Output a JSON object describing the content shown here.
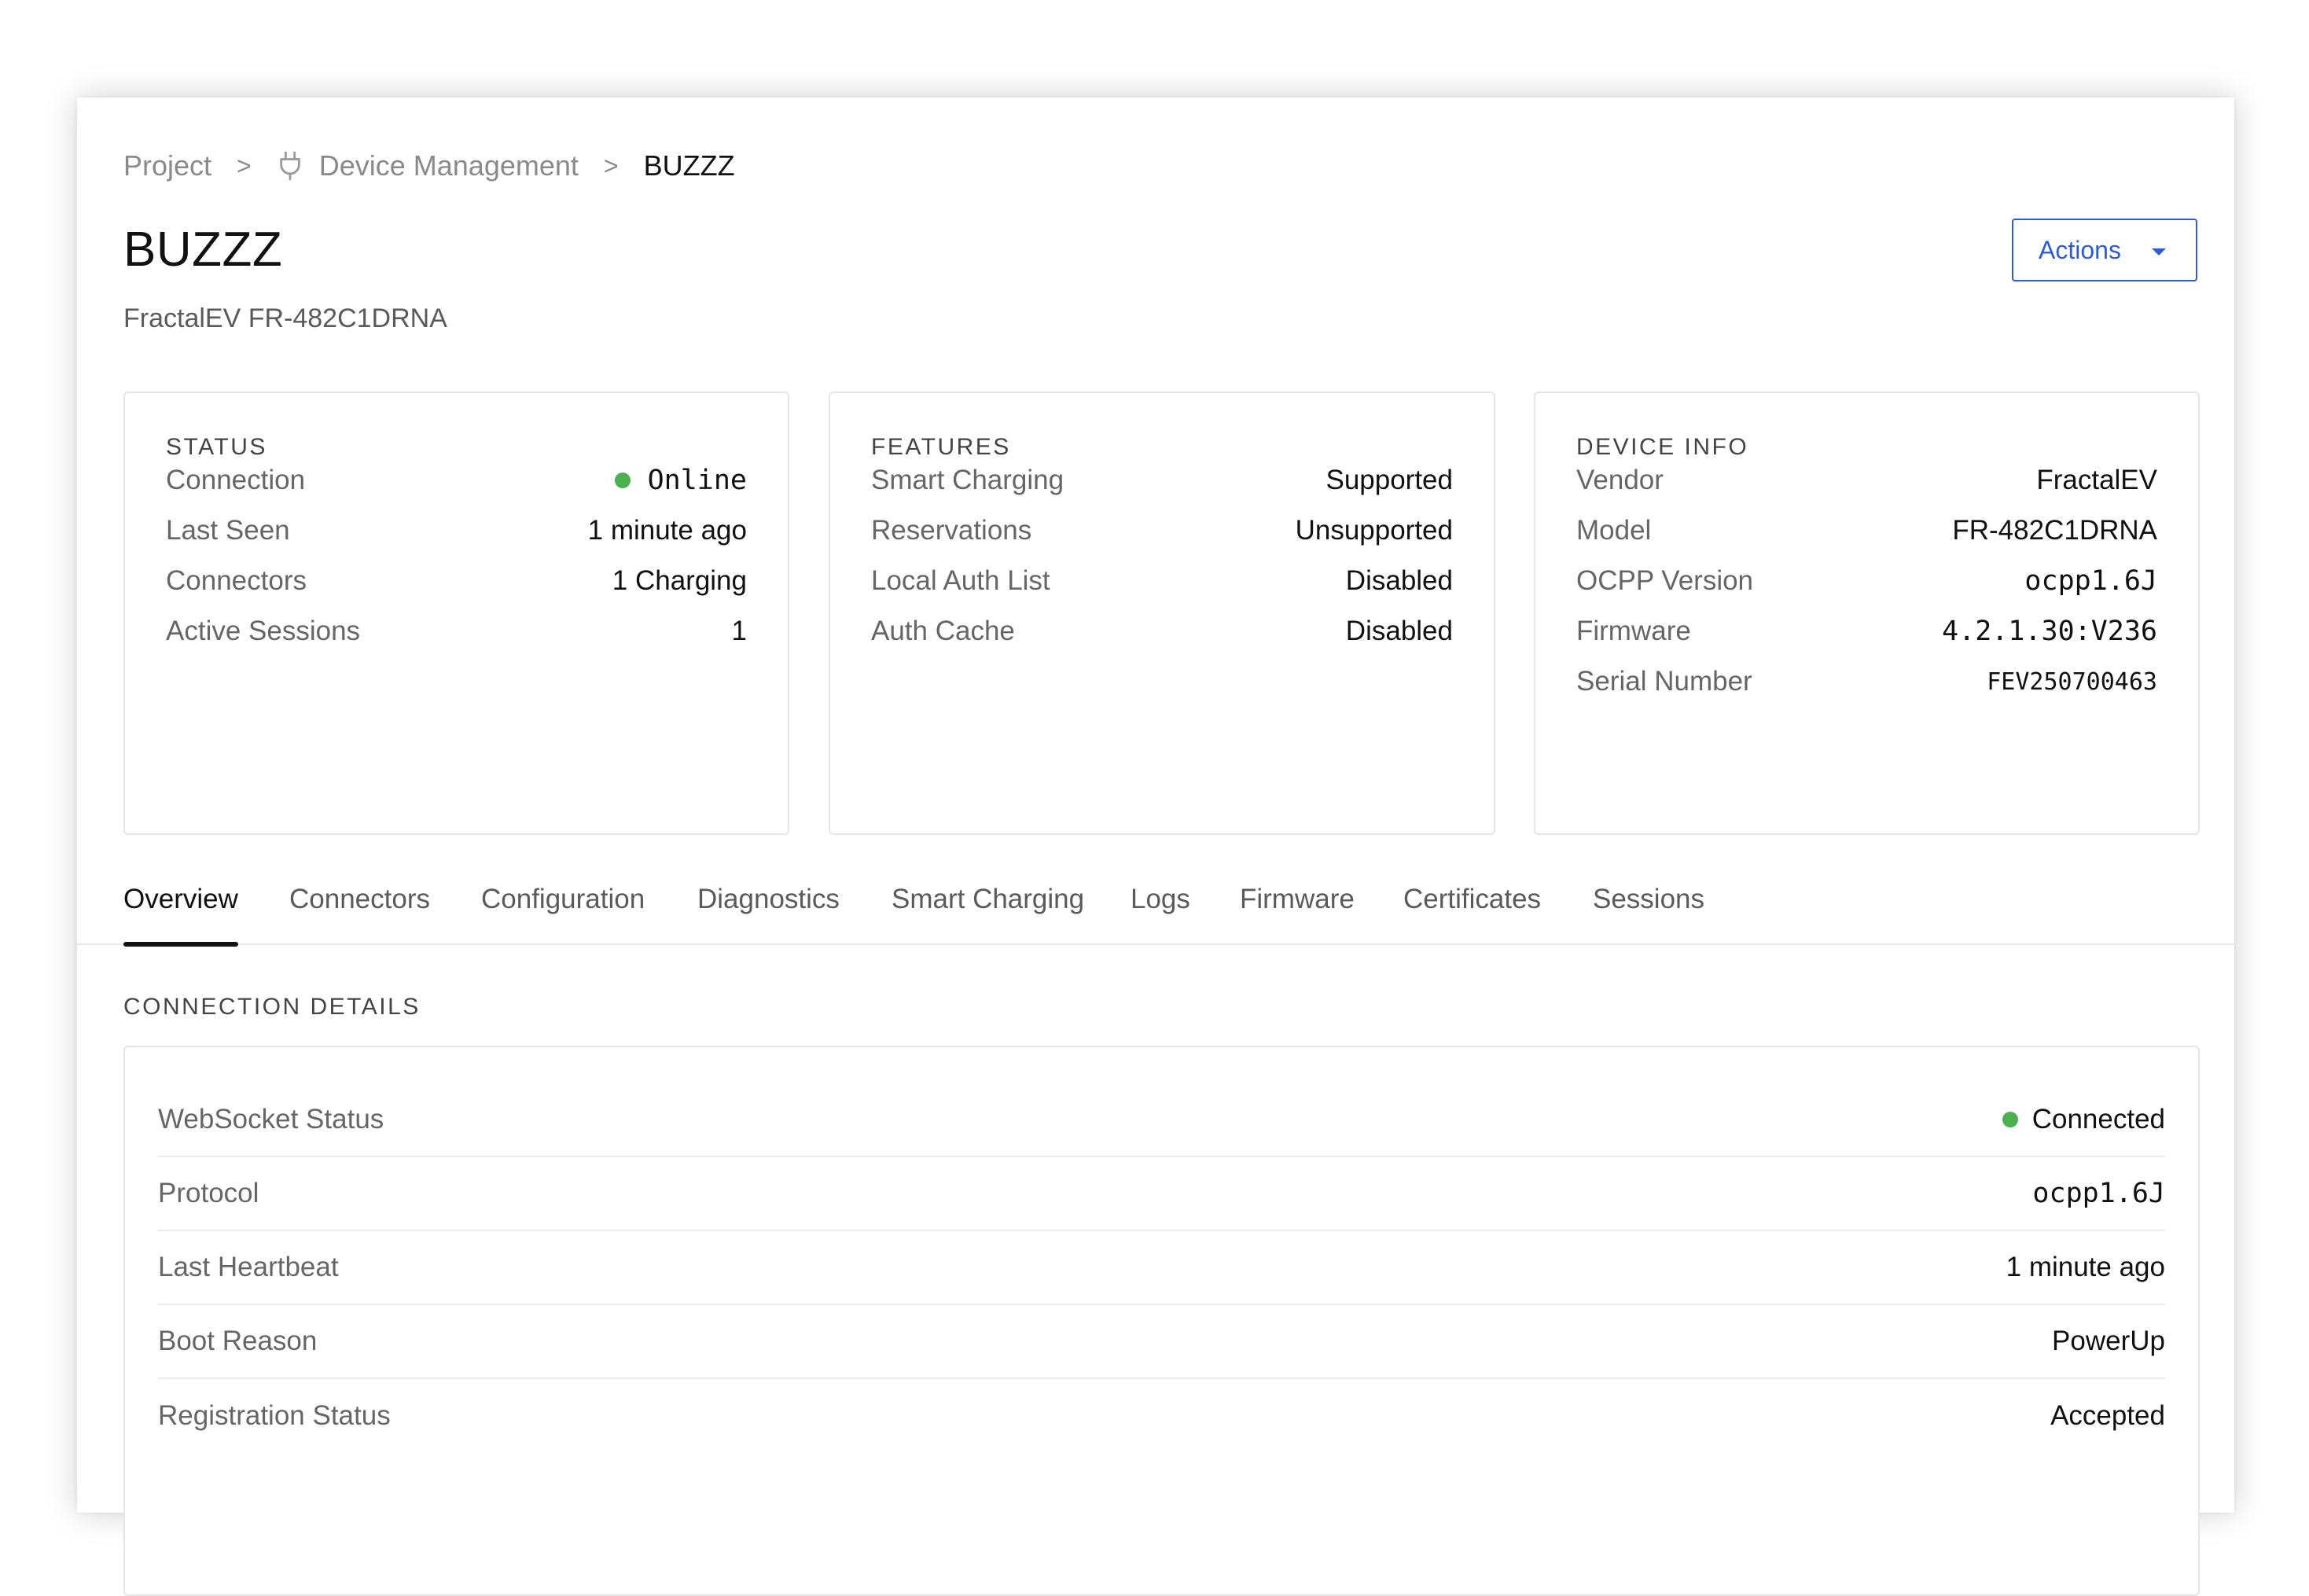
{
  "breadcrumb": {
    "project": "Project",
    "separator": ">",
    "device_management": "Device Management",
    "current": "BUZZZ",
    "icon": "plug-icon"
  },
  "header": {
    "title": "BUZZZ",
    "subtitle": "FractalEV FR-482C1DRNA",
    "actions_label": "Actions"
  },
  "status_card": {
    "title": "STATUS",
    "rows": [
      {
        "key": "Connection",
        "value": "Online"
      },
      {
        "key": "Last Seen",
        "value": "1 minute ago"
      },
      {
        "key": "Connectors",
        "value": "1 Charging"
      },
      {
        "key": "Active Sessions",
        "value": "1"
      }
    ]
  },
  "features_card": {
    "title": "FEATURES",
    "rows": [
      {
        "key": "Smart Charging",
        "value": "Supported"
      },
      {
        "key": "Reservations",
        "value": "Unsupported"
      },
      {
        "key": "Local Auth List",
        "value": "Disabled"
      },
      {
        "key": "Auth Cache",
        "value": "Disabled"
      }
    ]
  },
  "device_info_card": {
    "title": "DEVICE INFO",
    "rows": [
      {
        "key": "Vendor",
        "value": "FractalEV"
      },
      {
        "key": "Model",
        "value": "FR-482C1DRNA"
      },
      {
        "key": "OCPP Version",
        "value": "ocpp1.6J"
      },
      {
        "key": "Firmware",
        "value": "4.2.1.30:V236"
      },
      {
        "key": "Serial Number",
        "value": "FEV250700463"
      }
    ]
  },
  "tabs": [
    {
      "label": "Overview",
      "active": true
    },
    {
      "label": "Connectors"
    },
    {
      "label": "Configuration"
    },
    {
      "label": "Diagnostics"
    },
    {
      "label": "Smart Charging"
    },
    {
      "label": "Logs"
    },
    {
      "label": "Firmware"
    },
    {
      "label": "Certificates"
    },
    {
      "label": "Sessions"
    }
  ],
  "connection_details": {
    "title": "CONNECTION DETAILS",
    "rows": [
      {
        "key": "WebSocket Status",
        "value": "Connected"
      },
      {
        "key": "Protocol",
        "value": "ocpp1.6J"
      },
      {
        "key": "Last Heartbeat",
        "value": "1 minute ago"
      },
      {
        "key": "Boot Reason",
        "value": "PowerUp"
      },
      {
        "key": "Registration Status",
        "value": "Accepted"
      }
    ]
  },
  "colors": {
    "accent": "#2f5bd3",
    "online": "#4caf50",
    "supported": "#4a9e4e"
  }
}
